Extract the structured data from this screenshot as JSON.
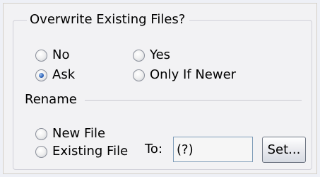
{
  "overwrite": {
    "title": "Overwrite Existing Files?",
    "options": [
      {
        "label": "No",
        "checked": false
      },
      {
        "label": "Yes",
        "checked": false
      },
      {
        "label": "Ask",
        "checked": true
      },
      {
        "label": "Only If Newer",
        "checked": false
      }
    ]
  },
  "rename": {
    "title": "Rename",
    "options": [
      {
        "label": "New File",
        "checked": false
      },
      {
        "label": "Existing File",
        "checked": false
      }
    ],
    "to_label": "To:",
    "to_value": "(?)",
    "set_button_label": "Set..."
  }
}
